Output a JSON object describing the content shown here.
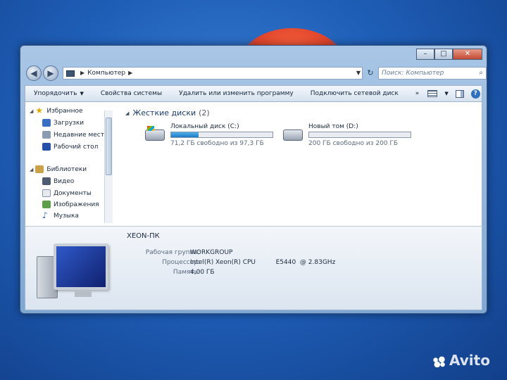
{
  "window": {
    "address_path": "Компьютер",
    "search_placeholder": "Поиск: Компьютер"
  },
  "toolbar": {
    "organize": "Упорядочить",
    "system_properties": "Свойства системы",
    "uninstall": "Удалить или изменить программу",
    "map_drive": "Подключить сетевой диск",
    "more": "»"
  },
  "navpane": {
    "favorites": "Избранное",
    "downloads": "Загрузки",
    "recent": "Недавние места",
    "desktop": "Рабочий стол",
    "libraries": "Библиотеки",
    "video": "Видео",
    "documents": "Документы",
    "pictures": "Изображения",
    "music": "Музыка"
  },
  "group": {
    "title": "Жесткие диски",
    "count": "(2)"
  },
  "drives": [
    {
      "name": "Локальный диск (C:)",
      "free_text": "71,2 ГБ свободно из 97,3 ГБ",
      "used_fraction": 0.27
    },
    {
      "name": "Новый том (D:)",
      "free_text": "200 ГБ свободно из 200 ГБ",
      "used_fraction": 0.0
    }
  ],
  "details": {
    "pc_name": "XEON-ПК",
    "workgroup_label": "Рабочая группа:",
    "workgroup_value": "WORKGROUP",
    "cpu_label": "Процессор:",
    "cpu_value": "Intel(R) Xeon(R) CPU          E5440  @ 2.83GHz",
    "ram_label": "Память:",
    "ram_value": "4,00 ГБ"
  },
  "watermark": "Avito",
  "colors": {
    "accent": "#1f79c6",
    "desktop": "#1f5fb8"
  }
}
